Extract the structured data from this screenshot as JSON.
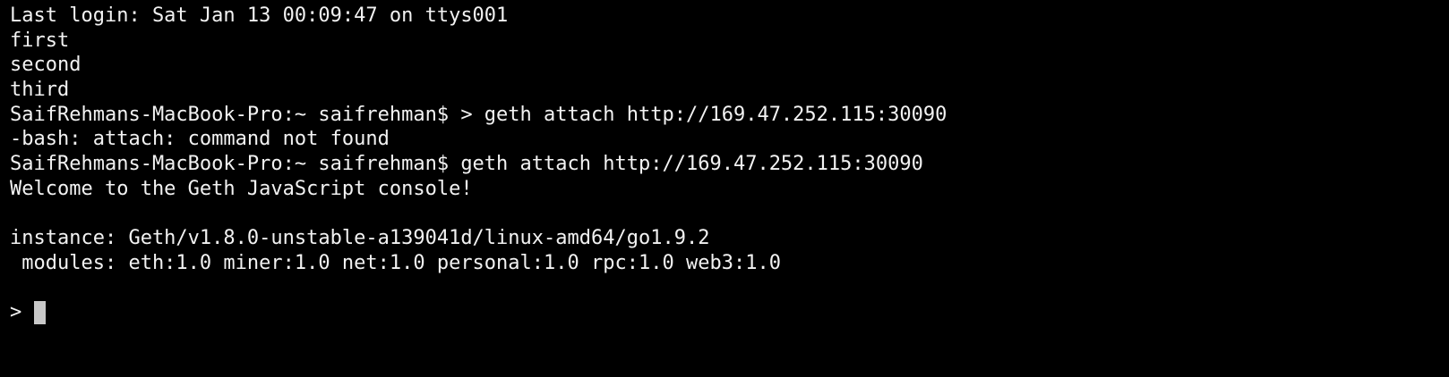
{
  "colors": {
    "background": "#000000",
    "text": "#f2f2f2",
    "cursor": "#c8c8c8"
  },
  "terminal": {
    "lines": [
      "Last login: Sat Jan 13 00:09:47 on ttys001",
      "first",
      "second",
      "third",
      "SaifRehmans-MacBook-Pro:~ saifrehman$ > geth attach http://169.47.252.115:30090",
      "-bash: attach: command not found",
      "SaifRehmans-MacBook-Pro:~ saifrehman$ geth attach http://169.47.252.115:30090",
      "Welcome to the Geth JavaScript console!",
      "",
      "instance: Geth/v1.8.0-unstable-a139041d/linux-amd64/go1.9.2",
      " modules: eth:1.0 miner:1.0 net:1.0 personal:1.0 rpc:1.0 web3:1.0",
      ""
    ],
    "prompt": "> "
  }
}
